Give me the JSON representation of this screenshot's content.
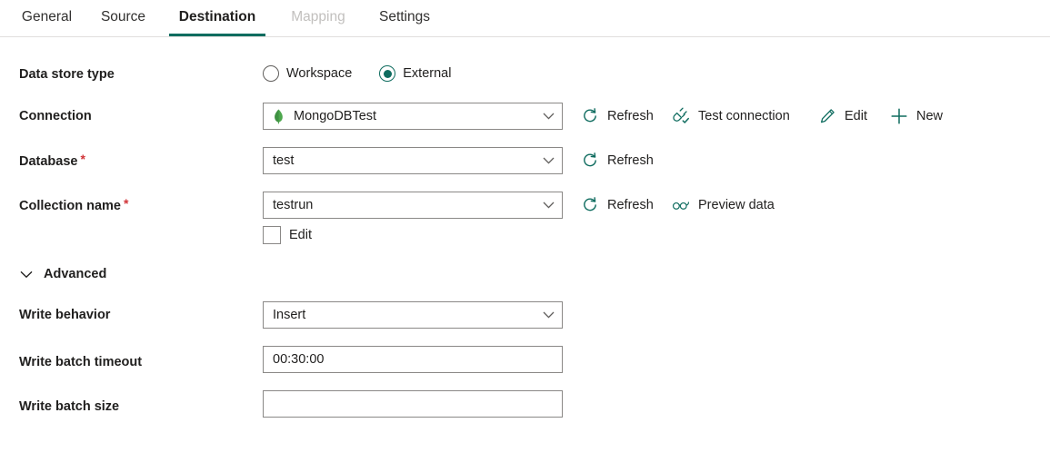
{
  "tabs": [
    {
      "id": "general",
      "label": "General",
      "state": "normal"
    },
    {
      "id": "source",
      "label": "Source",
      "state": "normal"
    },
    {
      "id": "destination",
      "label": "Destination",
      "state": "active"
    },
    {
      "id": "mapping",
      "label": "Mapping",
      "state": "disabled"
    },
    {
      "id": "settings",
      "label": "Settings",
      "state": "normal"
    }
  ],
  "form": {
    "data_store_type": {
      "label": "Data store type",
      "options": [
        {
          "label": "Workspace",
          "selected": false
        },
        {
          "label": "External",
          "selected": true
        }
      ]
    },
    "connection": {
      "label": "Connection",
      "value": "MongoDBTest",
      "icon": "mongodb-leaf-icon",
      "required": false,
      "actions": [
        {
          "label": "Refresh",
          "icon": "refresh-icon"
        },
        {
          "label": "Test connection",
          "icon": "plug-check-icon"
        },
        {
          "label": "Edit",
          "icon": "pencil-icon"
        },
        {
          "label": "New",
          "icon": "plus-icon"
        }
      ]
    },
    "database": {
      "label": "Database",
      "required": true,
      "required_marker": "*",
      "value": "test",
      "actions": [
        {
          "label": "Refresh",
          "icon": "refresh-icon"
        }
      ]
    },
    "collection_name": {
      "label": "Collection name",
      "required": true,
      "required_marker": "*",
      "value": "testrun",
      "actions": [
        {
          "label": "Refresh",
          "icon": "refresh-icon"
        },
        {
          "label": "Preview data",
          "icon": "glasses-icon"
        }
      ],
      "edit_checkbox": {
        "label": "Edit",
        "checked": false
      }
    },
    "advanced": {
      "label": "Advanced",
      "expanded": true,
      "icon": "chevron-down-icon"
    },
    "write_behavior": {
      "label": "Write behavior",
      "value": "Insert"
    },
    "write_batch_timeout": {
      "label": "Write batch timeout",
      "value": "00:30:00",
      "placeholder": ""
    },
    "write_batch_size": {
      "label": "Write batch size",
      "value": "",
      "placeholder": ""
    }
  },
  "colors": {
    "accent_teal": "#0f6c5f",
    "icon_teal": "#0f6c5f",
    "required_red": "#d13438",
    "mongodb_green": "#4da74d",
    "disabled_gray": "#c2c0be"
  }
}
